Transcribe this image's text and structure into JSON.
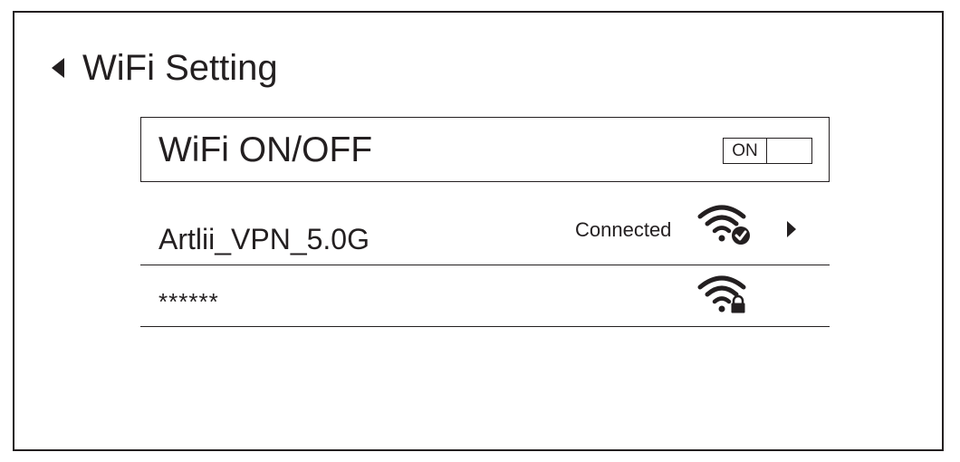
{
  "header": {
    "title": "WiFi Setting",
    "back_icon": "back-arrow-icon"
  },
  "wifi_toggle": {
    "label": "WiFi ON/OFF",
    "state_label": "ON",
    "state": true
  },
  "networks": [
    {
      "ssid": "Artlii_VPN_5.0G",
      "status": "Connected",
      "icon": "wifi-connected-icon",
      "has_chevron": true
    },
    {
      "ssid": "******",
      "status": "",
      "icon": "wifi-locked-icon",
      "has_chevron": false
    }
  ],
  "colors": {
    "foreground": "#231f20",
    "background": "#ffffff"
  }
}
